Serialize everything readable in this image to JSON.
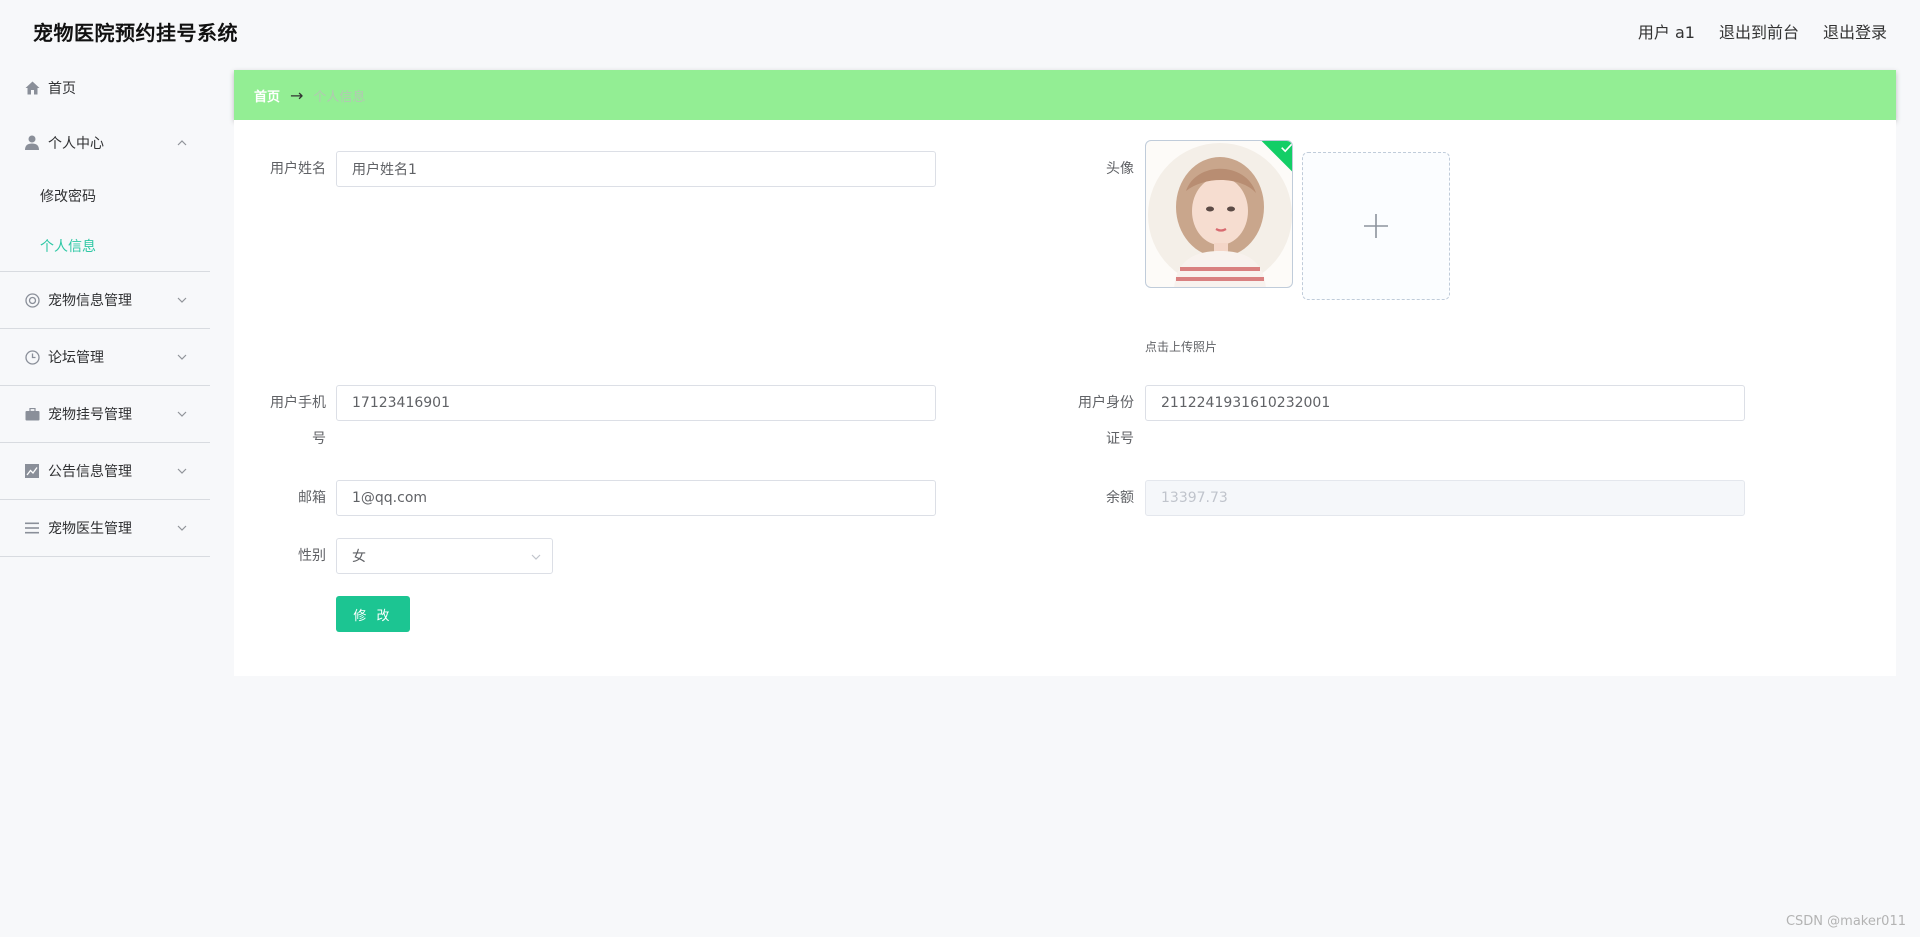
{
  "header": {
    "title": "宠物医院预约挂号系统",
    "user_label": "用户 a1",
    "to_front": "退出到前台",
    "logout": "退出登录"
  },
  "sidebar": {
    "items": [
      {
        "label": "首页",
        "icon": "home-icon"
      },
      {
        "label": "个人中心",
        "icon": "user-icon",
        "children": [
          {
            "label": "修改密码"
          },
          {
            "label": "个人信息",
            "active": true
          }
        ]
      },
      {
        "label": "宠物信息管理",
        "icon": "lifebuoy-icon"
      },
      {
        "label": "论坛管理",
        "icon": "clock-icon"
      },
      {
        "label": "宠物挂号管理",
        "icon": "briefcase-icon"
      },
      {
        "label": "公告信息管理",
        "icon": "chart-icon"
      },
      {
        "label": "宠物医生管理",
        "icon": "menu-lines-icon"
      }
    ]
  },
  "breadcrumb": {
    "home": "首页",
    "separator": "→",
    "current": "个人信息"
  },
  "form": {
    "name_label": "用户姓名",
    "name_value": "用户姓名1",
    "avatar_label": "头像",
    "upload_tip": "点击上传照片",
    "phone_label_l1": "用户手机",
    "phone_label_l2": "号",
    "phone_value": "17123416901",
    "id_label_l1": "用户身份",
    "id_label_l2": "证号",
    "id_value": "2112241931610232001",
    "email_label": "邮箱",
    "email_value": "1@qq.com",
    "balance_label": "余额",
    "balance_value": "13397.73",
    "gender_label": "性别",
    "gender_value": "女",
    "submit_label": "修 改"
  },
  "watermark": "CSDN @maker011",
  "colors": {
    "breadcrumb_bg": "#93ee94",
    "active_menu": "#2fc8a5",
    "submit_bg": "#1cc592"
  }
}
